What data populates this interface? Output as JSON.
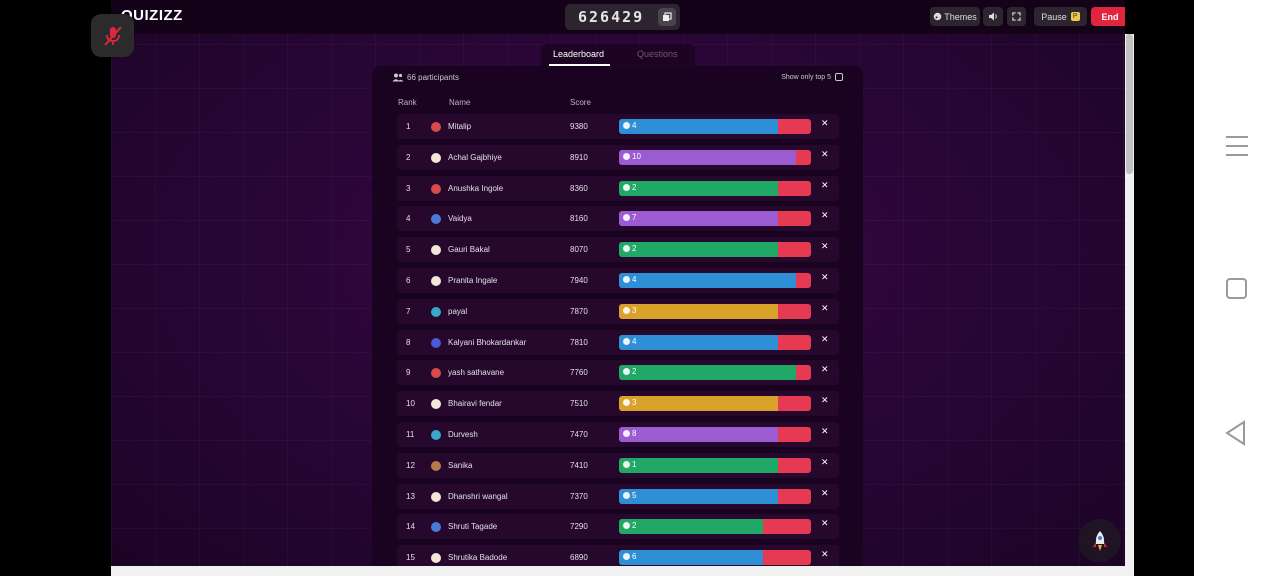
{
  "room_code": "626429",
  "app": {
    "logo_text": "QUIZIZZ"
  },
  "toolbar": {
    "themes_label": "Themes",
    "pause_label": "Pause",
    "pause_badge": "P",
    "end_label": "End"
  },
  "tabs": [
    {
      "label": "Leaderboard",
      "active": true
    },
    {
      "label": "Questions",
      "active": false
    }
  ],
  "leaderboard": {
    "participants_text": "66 participants",
    "top5_label": "Show only top 5",
    "columns": {
      "rank": "Rank",
      "name": "Name",
      "score": "Score"
    },
    "rows": [
      {
        "rank": "1",
        "name": "Mitalip",
        "score": "9380",
        "count": "4",
        "fill_fraction": 0.83,
        "color": "#2e8fd6",
        "avatar": "#d84a4a"
      },
      {
        "rank": "2",
        "name": "Achal Gajbhiye",
        "score": "8910",
        "count": "10",
        "fill_fraction": 0.92,
        "color": "#9a5cd0",
        "avatar": "#f3e7d5"
      },
      {
        "rank": "3",
        "name": "Anushka Ingole",
        "score": "8360",
        "count": "2",
        "fill_fraction": 0.83,
        "color": "#1fa866",
        "avatar": "#d84a4a"
      },
      {
        "rank": "4",
        "name": "Vaidya",
        "score": "8160",
        "count": "7",
        "fill_fraction": 0.83,
        "color": "#9a5cd0",
        "avatar": "#4a7ad8"
      },
      {
        "rank": "5",
        "name": "Gauri Bakal",
        "score": "8070",
        "count": "2",
        "fill_fraction": 0.83,
        "color": "#1fa866",
        "avatar": "#f3e7d5"
      },
      {
        "rank": "6",
        "name": "Pranita Ingale",
        "score": "7940",
        "count": "4",
        "fill_fraction": 0.92,
        "color": "#2e8fd6",
        "avatar": "#f3e7d5"
      },
      {
        "rank": "7",
        "name": "payal",
        "score": "7870",
        "count": "3",
        "fill_fraction": 0.83,
        "color": "#d9a22a",
        "avatar": "#3aa6c9"
      },
      {
        "rank": "8",
        "name": "Kalyani Bhokardankar",
        "score": "7810",
        "count": "4",
        "fill_fraction": 0.83,
        "color": "#2e8fd6",
        "avatar": "#4a5ad8"
      },
      {
        "rank": "9",
        "name": "yash sathavane",
        "score": "7760",
        "count": "2",
        "fill_fraction": 0.92,
        "color": "#1fa866",
        "avatar": "#d84a4a"
      },
      {
        "rank": "10",
        "name": "Bhairavi fendar",
        "score": "7510",
        "count": "3",
        "fill_fraction": 0.83,
        "color": "#d9a22a",
        "avatar": "#f3e7d5"
      },
      {
        "rank": "11",
        "name": "Durvesh",
        "score": "7470",
        "count": "8",
        "fill_fraction": 0.83,
        "color": "#9a5cd0",
        "avatar": "#3aa6c9"
      },
      {
        "rank": "12",
        "name": "Sanika",
        "score": "7410",
        "count": "1",
        "fill_fraction": 0.83,
        "color": "#1fa866",
        "avatar": "#b87a4a"
      },
      {
        "rank": "13",
        "name": "Dhanshri wangal",
        "score": "7370",
        "count": "5",
        "fill_fraction": 0.83,
        "color": "#2e8fd6",
        "avatar": "#f3e7d5"
      },
      {
        "rank": "14",
        "name": "Shruti Tagade",
        "score": "7290",
        "count": "2",
        "fill_fraction": 0.75,
        "color": "#1fa866",
        "avatar": "#4a7ad8"
      },
      {
        "rank": "15",
        "name": "Shrutika Badode",
        "score": "6890",
        "count": "6",
        "fill_fraction": 0.75,
        "color": "#2e8fd6",
        "avatar": "#f3e7d5"
      }
    ]
  },
  "colors": {
    "background": "#2a0637",
    "accent_end": "#e0253f",
    "incorrect": "#e63a52"
  }
}
